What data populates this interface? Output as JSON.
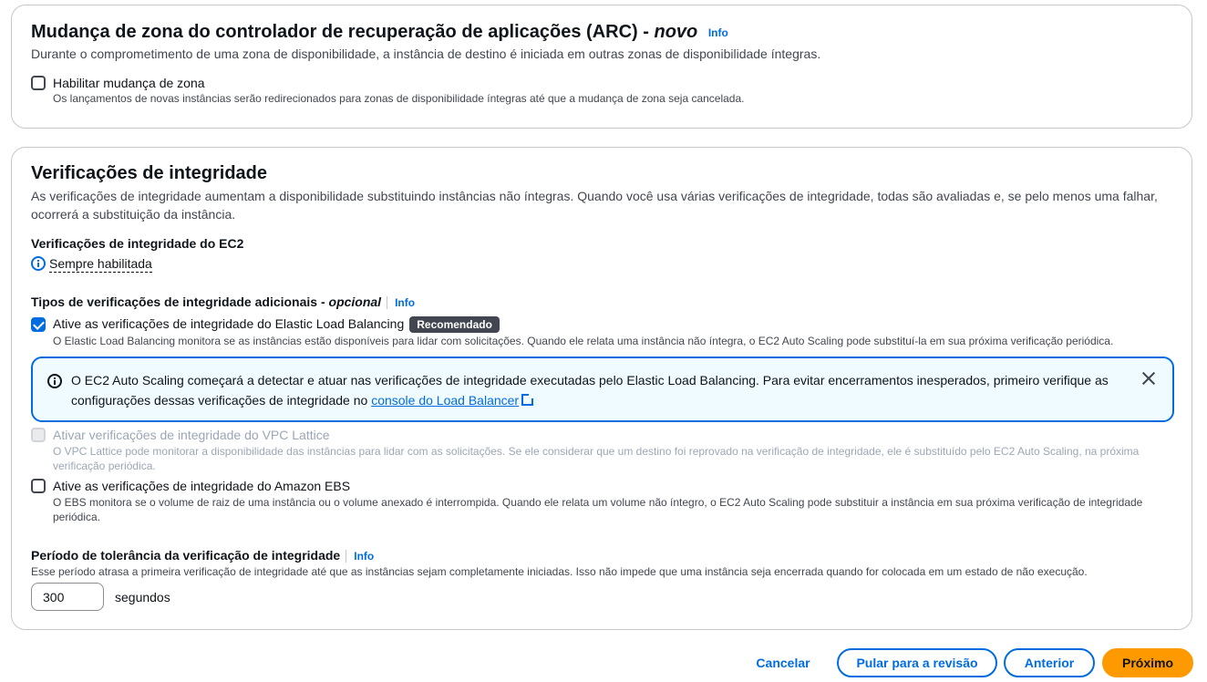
{
  "arc": {
    "title": "Mudança de zona do controlador de recuperação de aplicações (ARC) - ",
    "title_new": "novo",
    "info": "Info",
    "description": "Durante o comprometimento de uma zona de disponibilidade, a instância de destino é iniciada em outras zonas de disponibilidade íntegras.",
    "zonal_shift_label": "Habilitar mudança de zona",
    "zonal_shift_checked": false,
    "zonal_shift_description": "Os lançamentos de novas instâncias serão redirecionados para zonas de disponibilidade íntegras até que a mudança de zona seja cancelada."
  },
  "health": {
    "title": "Verificações de integridade",
    "description": "As verificações de integridade aumentam a disponibilidade substituindo instâncias não íntegras. Quando você usa várias verificações de integridade, todas são avaliadas e, se pelo menos uma falhar, ocorrerá a substituição da instância.",
    "ec2_label": "Verificações de integridade do EC2",
    "ec2_always": "Sempre habilitada",
    "additional_label": "Tipos de verificações de integridade adicionais - ",
    "additional_optional": "opcional",
    "additional_info": "Info",
    "elb": {
      "label": "Ative as verificações de integridade do Elastic Load Balancing",
      "badge": "Recomendado",
      "checked": true,
      "description": "O Elastic Load Balancing monitora se as instâncias estão disponíveis para lidar com solicitações. Quando ele relata uma instância não íntegra, o EC2 Auto Scaling pode substituí-la em sua próxima verificação periódica."
    },
    "alert": {
      "text": "O EC2 Auto Scaling começará a detectar e atuar nas verificações de integridade executadas pelo Elastic Load Balancing. Para evitar encerramentos inesperados, primeiro verifique as configurações dessas verificações de integridade no ",
      "link": "console do Load Balancer"
    },
    "vpc": {
      "label": "Ativar verificações de integridade do VPC Lattice",
      "checked": false,
      "disabled": true,
      "description": "O VPC Lattice pode monitorar a disponibilidade das instâncias para lidar com as solicitações. Se ele considerar que um destino foi reprovado na verificação de integridade, ele é substituído pelo EC2 Auto Scaling, na próxima verificação periódica."
    },
    "ebs": {
      "label": "Ative as verificações de integridade do Amazon EBS",
      "checked": false,
      "description": "O EBS monitora se o volume de raiz de uma instância ou o volume anexado é interrompida. Quando ele relata um volume não íntegro, o EC2 Auto Scaling pode substituir a instância em sua próxima verificação de integridade periódica."
    },
    "grace": {
      "label": "Período de tolerância da verificação de integridade",
      "info": "Info",
      "description": "Esse período atrasa a primeira verificação de integridade até que as instâncias sejam completamente iniciadas. Isso não impede que uma instância seja encerrada quando for colocada em um estado de não execução.",
      "value": "300",
      "unit": "segundos"
    }
  },
  "footer": {
    "cancel": "Cancelar",
    "skip": "Pular para a revisão",
    "previous": "Anterior",
    "next": "Próximo"
  }
}
